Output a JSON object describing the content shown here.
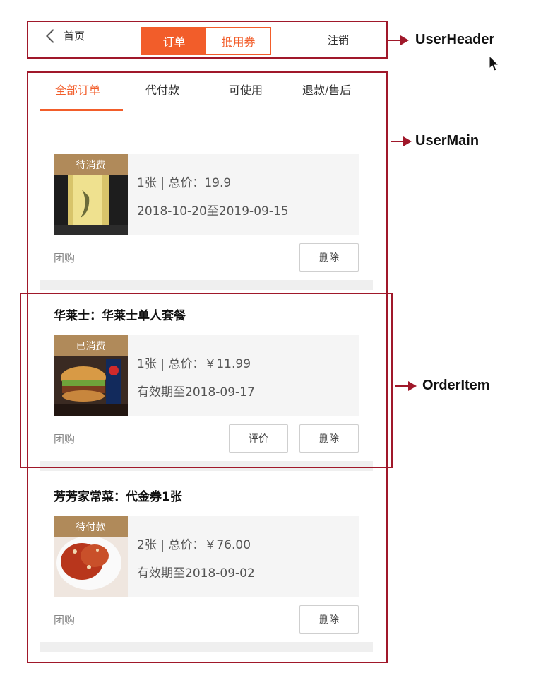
{
  "header": {
    "back_label": "首页",
    "tab_orders": "订单",
    "tab_coupons": "抵用券",
    "logout": "注销"
  },
  "tabs": [
    {
      "label": "全部订单",
      "active": true
    },
    {
      "label": "代付款",
      "active": false
    },
    {
      "label": "可使用",
      "active": false
    },
    {
      "label": "退款/售后",
      "active": false
    }
  ],
  "orders": [
    {
      "title": "",
      "status": "待消费",
      "line1": "1张 | 总价：19.9",
      "line2": "2018-10-20至2019-09-15",
      "type": "团购",
      "buttons": [
        "删除"
      ]
    },
    {
      "title": "华莱士：华莱士单人套餐",
      "status": "已消费",
      "line1": "1张 | 总价：￥11.99",
      "line2": "有效期至2018-09-17",
      "type": "团购",
      "buttons": [
        "评价",
        "删除"
      ]
    },
    {
      "title": "芳芳家常菜：代金券1张",
      "status": "待付款",
      "line1": "2张 | 总价：￥76.00",
      "line2": "有效期至2018-09-02",
      "type": "团购",
      "buttons": [
        "删除"
      ]
    }
  ],
  "annotations": {
    "user_header": "UserHeader",
    "user_main": "UserMain",
    "order_item": "OrderItem"
  },
  "colors": {
    "accent": "#f25d2a",
    "status_badge": "#b08a5a",
    "annotation": "#a0182a"
  }
}
